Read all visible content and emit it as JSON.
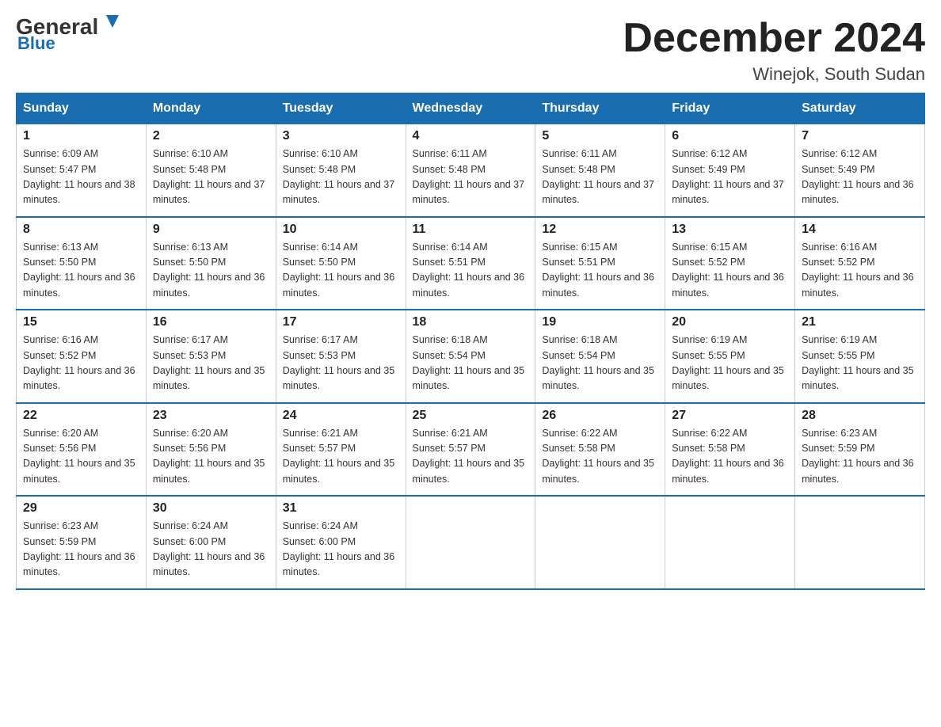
{
  "logo": {
    "general": "General",
    "blue": "Blue"
  },
  "title": "December 2024",
  "location": "Winejok, South Sudan",
  "days_of_week": [
    "Sunday",
    "Monday",
    "Tuesday",
    "Wednesday",
    "Thursday",
    "Friday",
    "Saturday"
  ],
  "weeks": [
    [
      {
        "day": "1",
        "sunrise": "6:09 AM",
        "sunset": "5:47 PM",
        "daylight": "11 hours and 38 minutes."
      },
      {
        "day": "2",
        "sunrise": "6:10 AM",
        "sunset": "5:48 PM",
        "daylight": "11 hours and 37 minutes."
      },
      {
        "day": "3",
        "sunrise": "6:10 AM",
        "sunset": "5:48 PM",
        "daylight": "11 hours and 37 minutes."
      },
      {
        "day": "4",
        "sunrise": "6:11 AM",
        "sunset": "5:48 PM",
        "daylight": "11 hours and 37 minutes."
      },
      {
        "day": "5",
        "sunrise": "6:11 AM",
        "sunset": "5:48 PM",
        "daylight": "11 hours and 37 minutes."
      },
      {
        "day": "6",
        "sunrise": "6:12 AM",
        "sunset": "5:49 PM",
        "daylight": "11 hours and 37 minutes."
      },
      {
        "day": "7",
        "sunrise": "6:12 AM",
        "sunset": "5:49 PM",
        "daylight": "11 hours and 36 minutes."
      }
    ],
    [
      {
        "day": "8",
        "sunrise": "6:13 AM",
        "sunset": "5:50 PM",
        "daylight": "11 hours and 36 minutes."
      },
      {
        "day": "9",
        "sunrise": "6:13 AM",
        "sunset": "5:50 PM",
        "daylight": "11 hours and 36 minutes."
      },
      {
        "day": "10",
        "sunrise": "6:14 AM",
        "sunset": "5:50 PM",
        "daylight": "11 hours and 36 minutes."
      },
      {
        "day": "11",
        "sunrise": "6:14 AM",
        "sunset": "5:51 PM",
        "daylight": "11 hours and 36 minutes."
      },
      {
        "day": "12",
        "sunrise": "6:15 AM",
        "sunset": "5:51 PM",
        "daylight": "11 hours and 36 minutes."
      },
      {
        "day": "13",
        "sunrise": "6:15 AM",
        "sunset": "5:52 PM",
        "daylight": "11 hours and 36 minutes."
      },
      {
        "day": "14",
        "sunrise": "6:16 AM",
        "sunset": "5:52 PM",
        "daylight": "11 hours and 36 minutes."
      }
    ],
    [
      {
        "day": "15",
        "sunrise": "6:16 AM",
        "sunset": "5:52 PM",
        "daylight": "11 hours and 36 minutes."
      },
      {
        "day": "16",
        "sunrise": "6:17 AM",
        "sunset": "5:53 PM",
        "daylight": "11 hours and 35 minutes."
      },
      {
        "day": "17",
        "sunrise": "6:17 AM",
        "sunset": "5:53 PM",
        "daylight": "11 hours and 35 minutes."
      },
      {
        "day": "18",
        "sunrise": "6:18 AM",
        "sunset": "5:54 PM",
        "daylight": "11 hours and 35 minutes."
      },
      {
        "day": "19",
        "sunrise": "6:18 AM",
        "sunset": "5:54 PM",
        "daylight": "11 hours and 35 minutes."
      },
      {
        "day": "20",
        "sunrise": "6:19 AM",
        "sunset": "5:55 PM",
        "daylight": "11 hours and 35 minutes."
      },
      {
        "day": "21",
        "sunrise": "6:19 AM",
        "sunset": "5:55 PM",
        "daylight": "11 hours and 35 minutes."
      }
    ],
    [
      {
        "day": "22",
        "sunrise": "6:20 AM",
        "sunset": "5:56 PM",
        "daylight": "11 hours and 35 minutes."
      },
      {
        "day": "23",
        "sunrise": "6:20 AM",
        "sunset": "5:56 PM",
        "daylight": "11 hours and 35 minutes."
      },
      {
        "day": "24",
        "sunrise": "6:21 AM",
        "sunset": "5:57 PM",
        "daylight": "11 hours and 35 minutes."
      },
      {
        "day": "25",
        "sunrise": "6:21 AM",
        "sunset": "5:57 PM",
        "daylight": "11 hours and 35 minutes."
      },
      {
        "day": "26",
        "sunrise": "6:22 AM",
        "sunset": "5:58 PM",
        "daylight": "11 hours and 35 minutes."
      },
      {
        "day": "27",
        "sunrise": "6:22 AM",
        "sunset": "5:58 PM",
        "daylight": "11 hours and 36 minutes."
      },
      {
        "day": "28",
        "sunrise": "6:23 AM",
        "sunset": "5:59 PM",
        "daylight": "11 hours and 36 minutes."
      }
    ],
    [
      {
        "day": "29",
        "sunrise": "6:23 AM",
        "sunset": "5:59 PM",
        "daylight": "11 hours and 36 minutes."
      },
      {
        "day": "30",
        "sunrise": "6:24 AM",
        "sunset": "6:00 PM",
        "daylight": "11 hours and 36 minutes."
      },
      {
        "day": "31",
        "sunrise": "6:24 AM",
        "sunset": "6:00 PM",
        "daylight": "11 hours and 36 minutes."
      },
      null,
      null,
      null,
      null
    ]
  ]
}
